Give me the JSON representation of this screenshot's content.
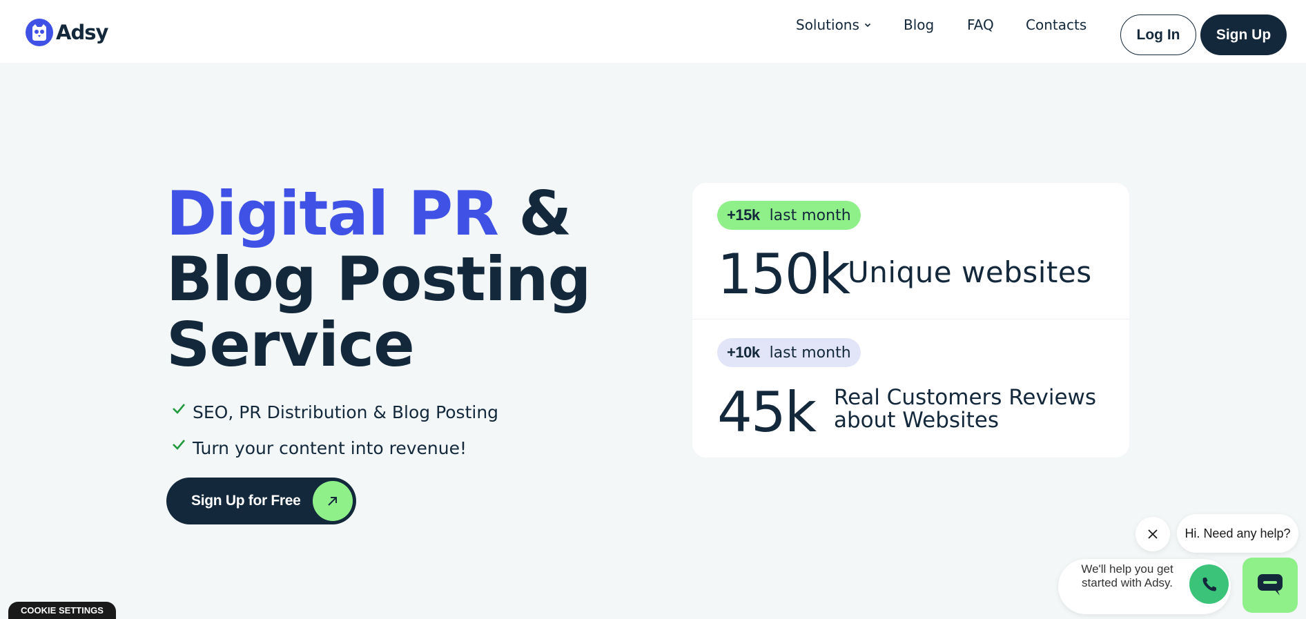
{
  "header": {
    "logo_text": "Adsy",
    "nav": {
      "solutions": "Solutions",
      "blog": "Blog",
      "faq": "FAQ",
      "contacts": "Contacts"
    },
    "login_label": "Log In",
    "signup_label": "Sign Up"
  },
  "hero": {
    "title_accent": "Digital PR",
    "title_amp": " &",
    "title_line2": "Blog Posting",
    "title_line3": "Service",
    "checks": [
      "SEO, PR Distribution & Blog Posting",
      "Turn your content into revenue!"
    ],
    "cta_label": "Sign Up for Free"
  },
  "stats": [
    {
      "badge_value": "+15k",
      "badge_text": "last month",
      "number": "150k",
      "description": "Unique websites",
      "badge_color": "#8ff08a"
    },
    {
      "badge_value": "+10k",
      "badge_text": "last month",
      "number": "45k",
      "description_line1": "Real Customers Reviews",
      "description_line2": "about Websites",
      "badge_color": "#e2e4f7"
    }
  ],
  "cookie": {
    "label": "COOKIE SETTINGS"
  },
  "chat": {
    "greeting": "Hi. Need any help?",
    "help_text": "We'll help you get started with Adsy."
  },
  "colors": {
    "accent": "#4052e6",
    "dark": "#13283a",
    "green": "#8ff08a",
    "background": "#f3f7f7"
  },
  "icons": [
    "logo-owl-icon",
    "chevron-down-icon",
    "check-icon",
    "arrow-up-right-icon",
    "close-icon",
    "phone-icon",
    "chat-icon"
  ]
}
